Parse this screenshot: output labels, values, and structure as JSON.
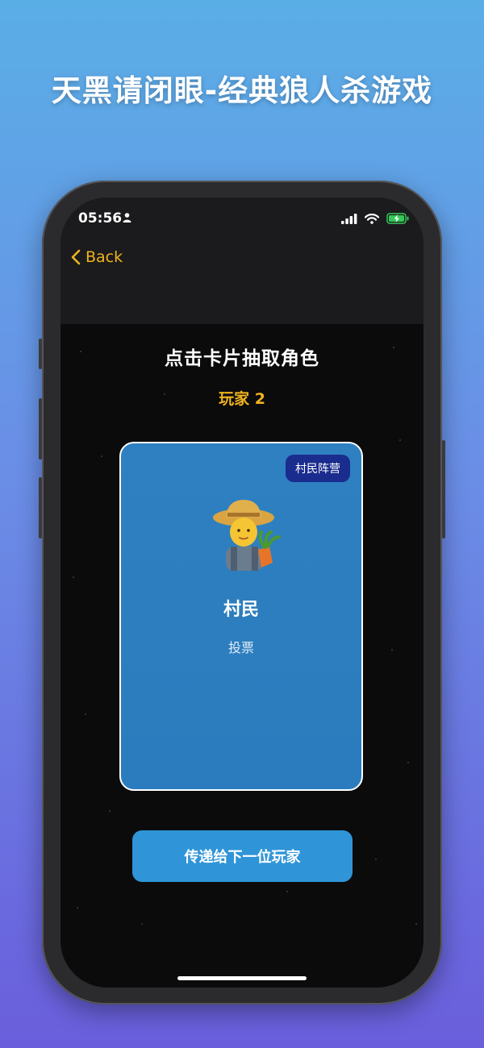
{
  "banner": {
    "title": "天黑请闭眼-经典狼人杀游戏"
  },
  "status_bar": {
    "time": "05:56"
  },
  "nav": {
    "back_label": "Back"
  },
  "main": {
    "prompt": "点击卡片抽取角色",
    "player_label": "玩家 2",
    "card": {
      "camp_badge": "村民阵营",
      "role_name": "村民",
      "role_ability": "投票",
      "avatar_icon": "farmer-emoji-icon"
    },
    "pass_button_label": "传递给下一位玩家"
  },
  "colors": {
    "accent_gold": "#f0b41e",
    "card_blue": "#2f80c0",
    "badge_navy": "#1a2c8e",
    "button_blue": "#2f95d8",
    "battery_green": "#34c759"
  }
}
